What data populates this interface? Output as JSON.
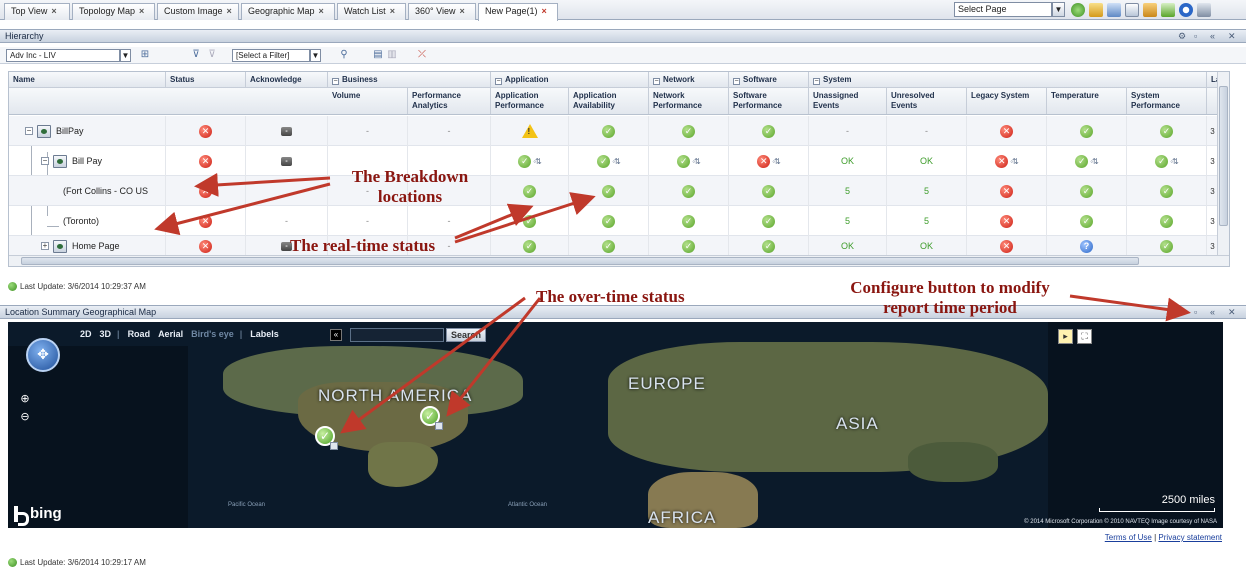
{
  "tabs": [
    {
      "label": "Top View"
    },
    {
      "label": "Topology Map"
    },
    {
      "label": "Custom Image"
    },
    {
      "label": "Geographic Map"
    },
    {
      "label": "Watch List"
    },
    {
      "label": "360° View"
    },
    {
      "label": "New Page(1)"
    }
  ],
  "select_page": "Select Page",
  "hierarchy": {
    "title": "Hierarchy",
    "view_combo": "Adv Inc - LIV",
    "filter_combo": "[Select a Filter]",
    "columns": {
      "name": "Name",
      "status": "Status",
      "acknowledge": "Acknowledge",
      "groups": {
        "business": "Business",
        "application": "Application",
        "network": "Network",
        "software": "Software",
        "system": "System"
      },
      "volume": "Volume",
      "performance_analytics": "Performance Analytics",
      "application_performance": "Application Performance",
      "application_availability": "Application Availability",
      "network_performance": "Network Performance",
      "software_performance": "Software Performance",
      "unassigned_events": "Unassigned Events",
      "unresolved_events": "Unresolved Events",
      "legacy_system": "Legacy System",
      "temperature": "Temperature",
      "system_performance": "System Performance",
      "last": "Las"
    },
    "rows": [
      {
        "name": "BillPay",
        "status": "err",
        "ack": "-",
        "volume": "-",
        "perf": "-",
        "app_perf": "warn",
        "app_avail": "ok",
        "net": "ok",
        "soft": "ok",
        "unassigned": "-",
        "unresolved": "-",
        "legacy": "err",
        "temp": "ok",
        "sysperf": "ok",
        "last": "3"
      },
      {
        "name": "Bill Pay",
        "status": "err",
        "ack": "-",
        "volume": "",
        "perf": "",
        "app_perf": "ok",
        "app_avail": "ok",
        "net": "ok",
        "soft": "err",
        "unassigned": "OK",
        "unresolved": "OK",
        "legacy": "err",
        "temp": "ok",
        "sysperf": "ok",
        "last": "3"
      },
      {
        "name": "(Fort Collins - CO US",
        "status": "err",
        "ack": "",
        "volume": "-",
        "perf": "",
        "app_perf": "ok",
        "app_avail": "ok",
        "net": "ok",
        "soft": "ok",
        "unassigned": "5",
        "unresolved": "5",
        "legacy": "err",
        "temp": "ok",
        "sysperf": "ok",
        "last": "3"
      },
      {
        "name": "(Toronto)",
        "status": "err",
        "ack": "-",
        "volume": "-",
        "perf": "-",
        "app_perf": "ok",
        "app_avail": "ok",
        "net": "ok",
        "soft": "ok",
        "unassigned": "5",
        "unresolved": "5",
        "legacy": "err",
        "temp": "ok",
        "sysperf": "ok",
        "last": "3"
      },
      {
        "name": "Home Page",
        "status": "err",
        "ack": "-",
        "volume": "-",
        "perf": "-",
        "app_perf": "ok",
        "app_avail": "ok",
        "net": "ok",
        "soft": "ok",
        "unassigned": "OK",
        "unresolved": "OK",
        "legacy": "err",
        "temp": "unk",
        "sysperf": "ok",
        "last": "3"
      }
    ],
    "last_update": "Last Update: 3/6/2014 10:29:37 AM"
  },
  "map": {
    "title": "Location Summary Geographical Map",
    "modes": {
      "two_d": "2D",
      "three_d": "3D",
      "road": "Road",
      "aerial": "Aerial",
      "birdseye": "Bird's eye",
      "labels": "Labels"
    },
    "search_label": "Search",
    "labels": {
      "north_america": "NORTH AMERICA",
      "europe": "EUROPE",
      "asia": "ASIA",
      "africa": "AFRICA"
    },
    "oceans": {
      "pacific": "Pacific Ocean",
      "atlantic": "Atlantic Ocean"
    },
    "brand": "bing",
    "scale": "2500 miles",
    "attribution": "© 2014 Microsoft Corporation   © 2010 NAVTEQ   Image courtesy of NASA",
    "terms": "Terms of Use",
    "privacy": "Privacy statement",
    "separator": "|",
    "last_update": "Last Update: 3/6/2014 10:29:17 AM"
  },
  "annotations": {
    "breakdown_l1": "The Breakdown",
    "breakdown_l2": "locations",
    "realtime": "The real-time status",
    "overtime": "The over-time status",
    "configure_l1": "Configure button to modify",
    "configure_l2": "report time period"
  },
  "colors": {
    "annotation": "#c0392b",
    "ok": "#5aa52a",
    "error": "#cc1f14",
    "header": "#c8d2df"
  },
  "icons": [
    "close-icon",
    "filter-icon",
    "refresh-icon",
    "status-ok-icon",
    "status-error-icon",
    "warning-icon",
    "trend-icon",
    "compass-icon",
    "zoom-in-icon",
    "zoom-out-icon",
    "configure-icon"
  ]
}
